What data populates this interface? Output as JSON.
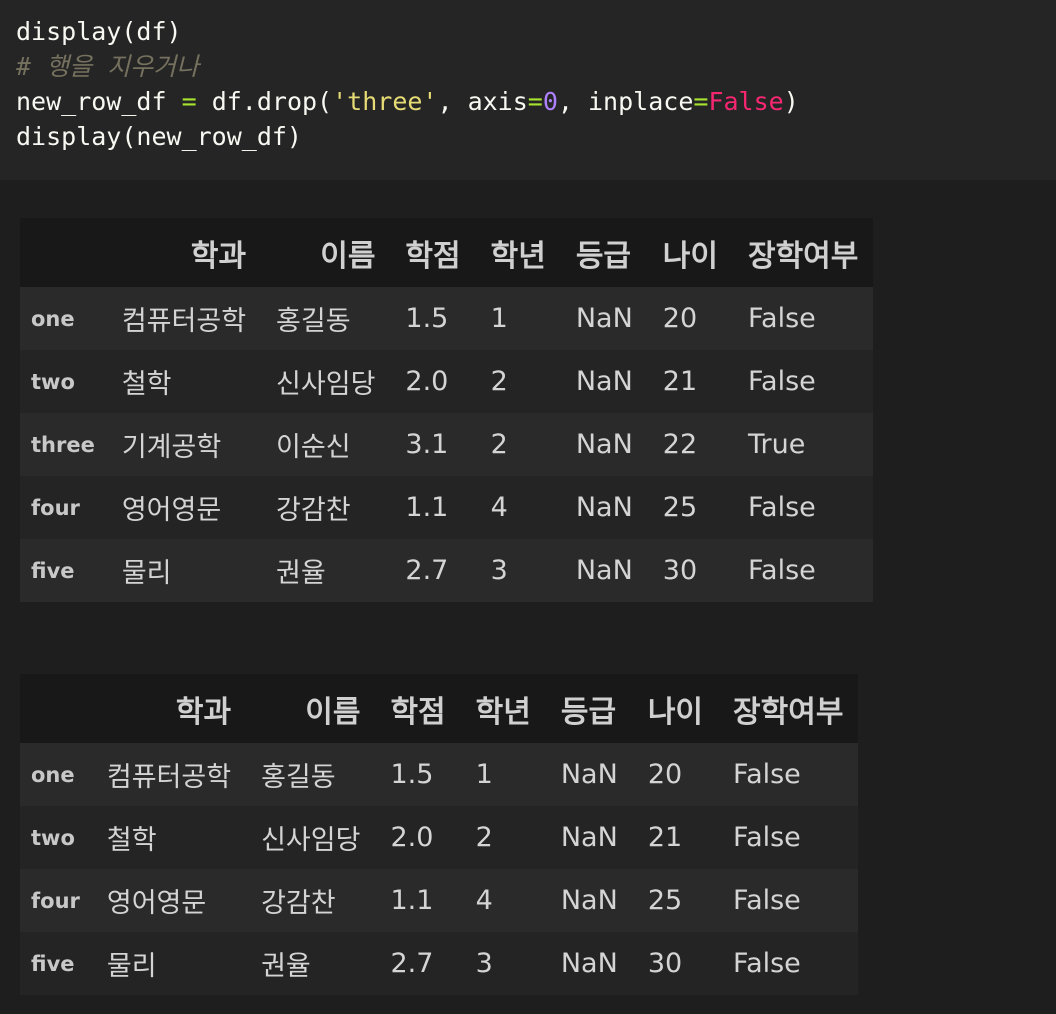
{
  "code": {
    "line1": "display(df)",
    "comment": "# 행을 지우거나",
    "line3": {
      "prefix": "new_row_df ",
      "eq": "=",
      "call": " df.drop(",
      "arg_str": "'three'",
      "mid": ", axis",
      "eq2": "=",
      "axis_val": "0",
      "mid2": ", inplace",
      "eq3": "=",
      "bool_val": "False",
      "close": ")"
    },
    "line4": "display(new_row_df)"
  },
  "table1": {
    "columns": [
      "",
      "학과",
      "이름",
      "학점",
      "학년",
      "등급",
      "나이",
      "장학여부"
    ],
    "rows": [
      {
        "index": "one",
        "cells": [
          "컴퓨터공학",
          "홍길동",
          "1.5",
          "1",
          "NaN",
          "20",
          "False"
        ]
      },
      {
        "index": "two",
        "cells": [
          "철학",
          "신사임당",
          "2.0",
          "2",
          "NaN",
          "21",
          "False"
        ]
      },
      {
        "index": "three",
        "cells": [
          "기계공학",
          "이순신",
          "3.1",
          "2",
          "NaN",
          "22",
          "True"
        ]
      },
      {
        "index": "four",
        "cells": [
          "영어영문",
          "강감찬",
          "1.1",
          "4",
          "NaN",
          "25",
          "False"
        ]
      },
      {
        "index": "five",
        "cells": [
          "물리",
          "권율",
          "2.7",
          "3",
          "NaN",
          "30",
          "False"
        ]
      }
    ]
  },
  "table2": {
    "columns": [
      "",
      "학과",
      "이름",
      "학점",
      "학년",
      "등급",
      "나이",
      "장학여부"
    ],
    "rows": [
      {
        "index": "one",
        "cells": [
          "컴퓨터공학",
          "홍길동",
          "1.5",
          "1",
          "NaN",
          "20",
          "False"
        ]
      },
      {
        "index": "two",
        "cells": [
          "철학",
          "신사임당",
          "2.0",
          "2",
          "NaN",
          "21",
          "False"
        ]
      },
      {
        "index": "four",
        "cells": [
          "영어영문",
          "강감찬",
          "1.1",
          "4",
          "NaN",
          "25",
          "False"
        ]
      },
      {
        "index": "five",
        "cells": [
          "물리",
          "권율",
          "2.7",
          "3",
          "NaN",
          "30",
          "False"
        ]
      }
    ]
  }
}
